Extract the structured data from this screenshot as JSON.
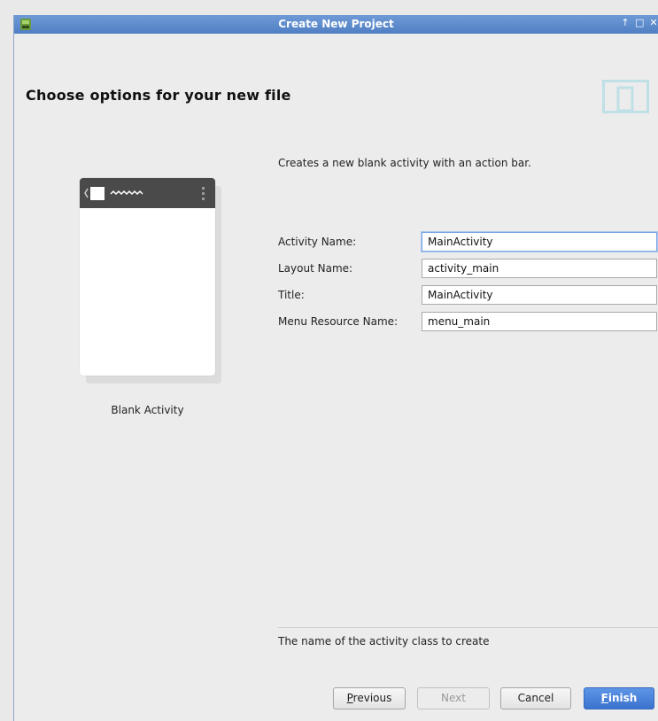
{
  "window": {
    "title": "Create New Project",
    "controls": [
      "↑",
      "□",
      "✕"
    ]
  },
  "header": {
    "title": "Choose options for your new file"
  },
  "template": {
    "caption": "Blank Activity"
  },
  "description": "Creates a new blank activity with an action bar.",
  "form": {
    "fields": [
      {
        "label": "Activity Name:",
        "value": "MainActivity"
      },
      {
        "label": "Layout Name:",
        "value": "activity_main"
      },
      {
        "label": "Title:",
        "value": "MainActivity"
      },
      {
        "label": "Menu Resource Name:",
        "value": "menu_main"
      }
    ]
  },
  "hint": "The name of the activity class to create",
  "buttons": {
    "previous": {
      "mnemonic": "P",
      "rest": "revious"
    },
    "next": "Next",
    "cancel": "Cancel",
    "finish": {
      "mnemonic": "F",
      "rest": "inish"
    }
  },
  "colors": {
    "titlebar": "#5b89cd",
    "accent": "#3b73cd",
    "graphic": "#bfe0e6"
  }
}
